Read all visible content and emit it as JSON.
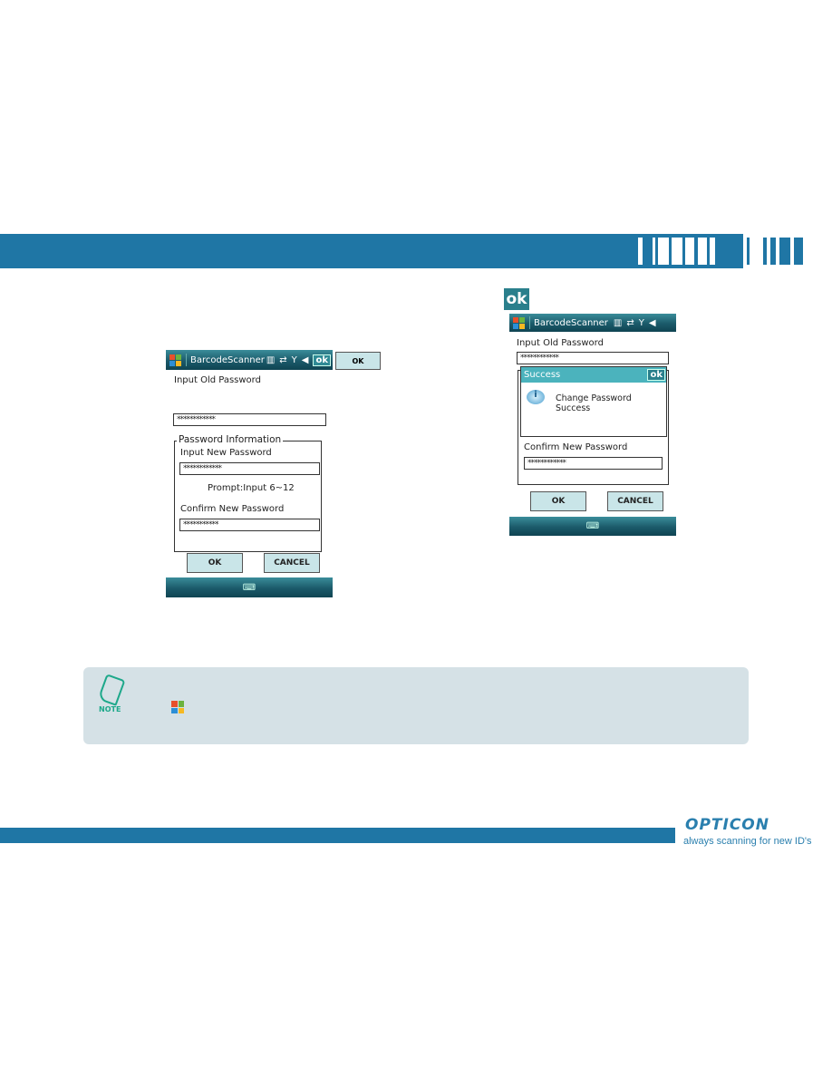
{
  "brand": {
    "name": "OPTICON",
    "tagline": "always scanning for new ID's",
    "color": "#1f76a5"
  },
  "inline_ok_button": "OK",
  "ok_icon_label": "ok",
  "left_screen": {
    "app_title": "BarcodeScanner",
    "title_ok": "ok",
    "old_password_label": "Input Old Password",
    "old_password_value": "************",
    "group_title": "Password Information",
    "new_password_label": "Input New Password",
    "new_password_value": "************",
    "prompt": "Prompt:Input 6~12",
    "confirm_label": "Confirm New Password",
    "confirm_value": "***********",
    "ok": "OK",
    "cancel": "CANCEL"
  },
  "right_screen": {
    "app_title": "BarcodeScanner",
    "old_password_label": "Input Old Password",
    "old_password_value": "************",
    "dialog_title": "Success",
    "dialog_ok": "ok",
    "dialog_message": "Change Password Success",
    "confirm_label": "Confirm New Password",
    "confirm_value": "************",
    "ok": "OK",
    "cancel": "CANCEL"
  },
  "note": {
    "label": "NOTE"
  }
}
